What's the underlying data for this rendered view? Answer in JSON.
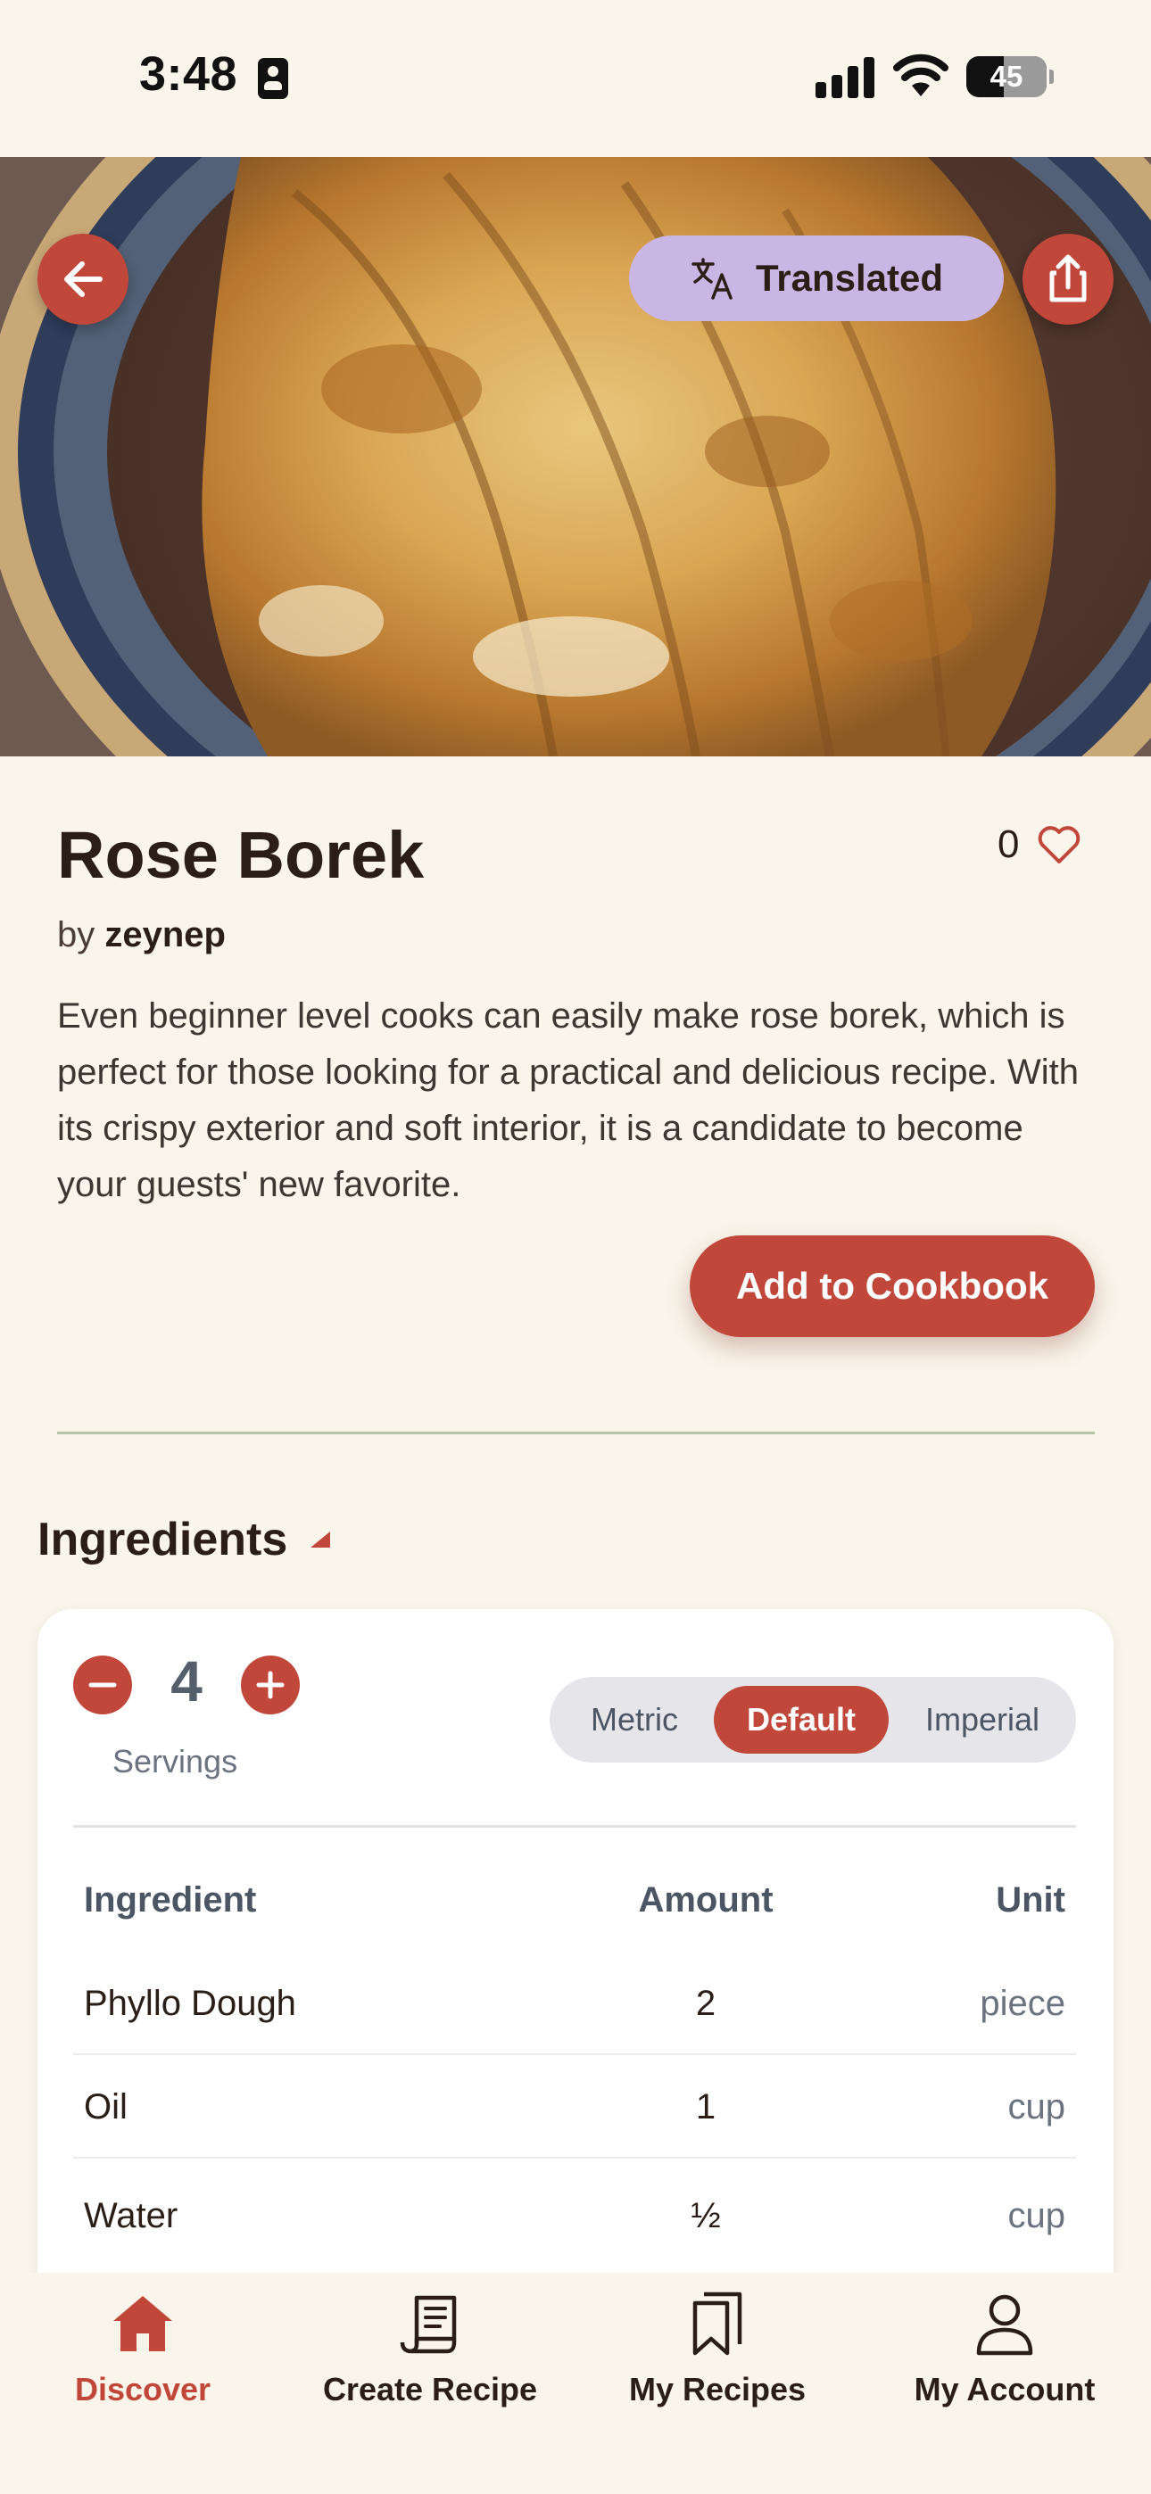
{
  "status_bar": {
    "time": "3:48",
    "battery": "45"
  },
  "hero": {
    "translated_label": "Translated",
    "icons": [
      "back-arrow-icon",
      "translate-icon",
      "share-icon"
    ]
  },
  "recipe": {
    "title": "Rose Borek",
    "by_prefix": "by",
    "author": "zeynep",
    "likes": "0",
    "description": "Even beginner level cooks can easily make rose borek, which is perfect for those looking for a practical and delicious recipe. With its crispy exterior and soft interior, it is a candidate to become your guests' new favorite.",
    "add_button": "Add to Cookbook"
  },
  "ingredients": {
    "section_title": "Ingredients",
    "servings": "4",
    "servings_label": "Servings",
    "units": {
      "metric": "Metric",
      "default": "Default",
      "imperial": "Imperial",
      "selected": "Default"
    },
    "headers": {
      "name": "Ingredient",
      "amount": "Amount",
      "unit": "Unit"
    },
    "rows": [
      {
        "name": "Phyllo Dough",
        "amount": "2",
        "unit": "piece"
      },
      {
        "name": "Oil",
        "amount": "1",
        "unit": "cup"
      },
      {
        "name": "Water",
        "amount": "½",
        "unit": "cup"
      }
    ]
  },
  "nav": {
    "items": [
      {
        "label": "Discover",
        "icon": "home-icon",
        "active": true
      },
      {
        "label": "Create Recipe",
        "icon": "recipe-scroll-icon",
        "active": false
      },
      {
        "label": "My Recipes",
        "icon": "bookmarks-icon",
        "active": false
      },
      {
        "label": "My Account",
        "icon": "user-icon",
        "active": false
      }
    ]
  },
  "colors": {
    "accent": "#c0473a",
    "background": "#f9f5eb",
    "translated_pill": "#c9b6e4"
  }
}
